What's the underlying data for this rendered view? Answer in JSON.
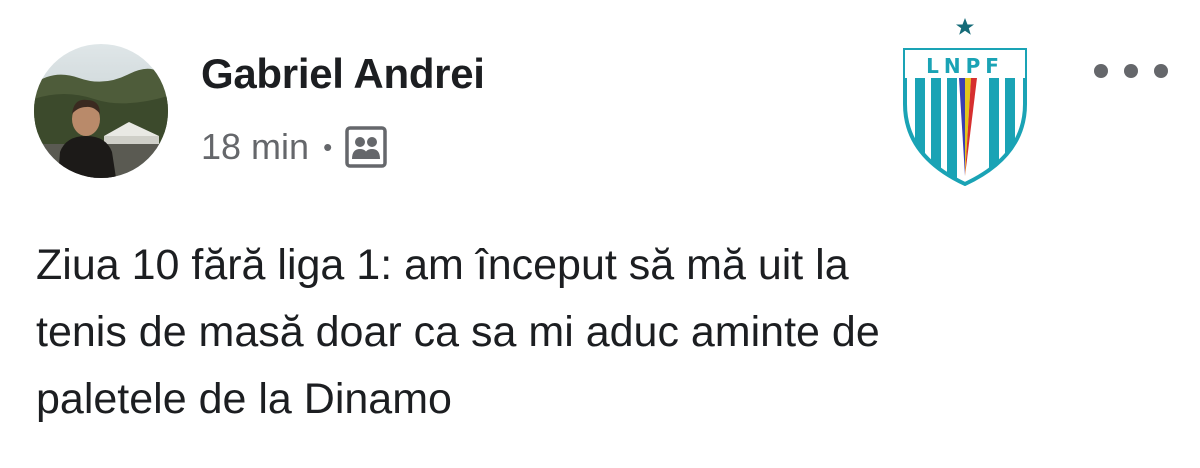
{
  "post": {
    "author": {
      "name": "Gabriel Andrei",
      "avatar_icon": "profile-photo"
    },
    "meta": {
      "time": "18 min",
      "separator": "•",
      "audience_icon": "group-icon"
    },
    "badge": {
      "letters": "LNPF",
      "icon": "lnpf-shield-logo"
    },
    "more_icon": "more-options-icon",
    "text_lines": [
      "Ziua 10 fără liga 1: am început să mă uit la",
      "tenis de masă doar ca sa mi aduc aminte de",
      "paletele de la Dinamo"
    ]
  },
  "colors": {
    "name_text": "#1c1e21",
    "meta_text": "#65676b",
    "background": "#ffffff",
    "badge_teal": "#1aa3b5"
  }
}
